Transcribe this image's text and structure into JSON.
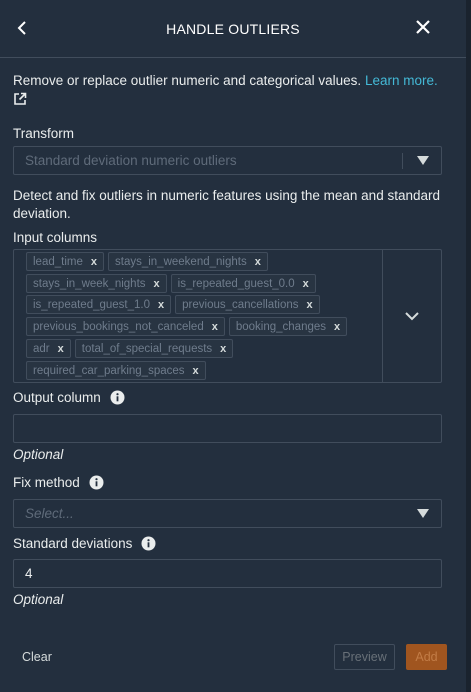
{
  "header": {
    "title": "HANDLE OUTLIERS",
    "back_icon": "chevron-left-icon",
    "close_icon": "close-icon"
  },
  "description": {
    "text": "Remove or replace outlier numeric and categorical values.",
    "link": "Learn more.",
    "link_icon": "external-link-icon"
  },
  "transform": {
    "label": "Transform",
    "value": "Standard deviation numeric outliers"
  },
  "transform_description": "Detect and fix outliers in numeric features using the mean and standard deviation.",
  "input_columns": {
    "label": "Input columns",
    "chips": [
      "lead_time",
      "stays_in_weekend_nights",
      "stays_in_week_nights",
      "is_repeated_guest_0.0",
      "is_repeated_guest_1.0",
      "previous_cancellations",
      "previous_bookings_not_canceled",
      "booking_changes",
      "adr",
      "total_of_special_requests",
      "required_car_parking_spaces"
    ],
    "remove_glyph": "x"
  },
  "output_column": {
    "label": "Output column",
    "value": "",
    "hint": "Optional"
  },
  "fix_method": {
    "label": "Fix method",
    "placeholder": "Select..."
  },
  "standard_deviations": {
    "label": "Standard deviations",
    "value": "4",
    "hint": "Optional"
  },
  "footer": {
    "clear": "Clear",
    "preview": "Preview",
    "add": "Add"
  },
  "colors": {
    "background": "#232f3e",
    "border": "#414d5c",
    "link": "#44b9d6",
    "add_button": "#a0551f"
  }
}
